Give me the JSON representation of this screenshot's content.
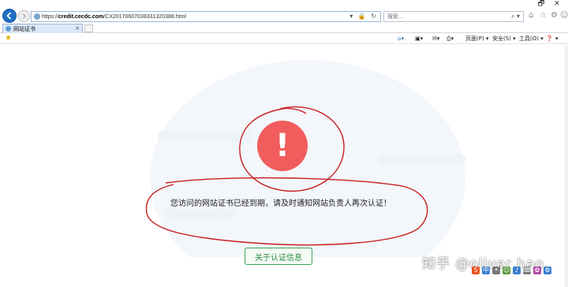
{
  "window": {
    "restore_glyph": "🗗",
    "close_glyph": "✕"
  },
  "address": {
    "url_prefix": "https://",
    "url_host": "credit.cecdc.com",
    "url_path": "/CX20170607038331320388.html",
    "tools": "▾ 🔒 ↻"
  },
  "search": {
    "placeholder": "搜索...",
    "icons": "⌕ ▾"
  },
  "tab": {
    "label": "网站证书",
    "close": "×"
  },
  "commandbar": {
    "page_menu": "页面(P) ▾",
    "safety_menu": "安全(S) ▾",
    "tools_menu": "工具(O) ▾",
    "help_menu": "▾"
  },
  "content": {
    "error_mark": "!",
    "message": "您访问的网站证书已经到期，请及时通知网站负责人再次认证！",
    "info_button": "关于认证信息"
  },
  "overlay": {
    "watermark": "知乎 @oliver hao"
  },
  "colors": {
    "error_red": "#f15c5c",
    "button_green": "#3aa356",
    "annotation_red": "#c81e1e"
  }
}
